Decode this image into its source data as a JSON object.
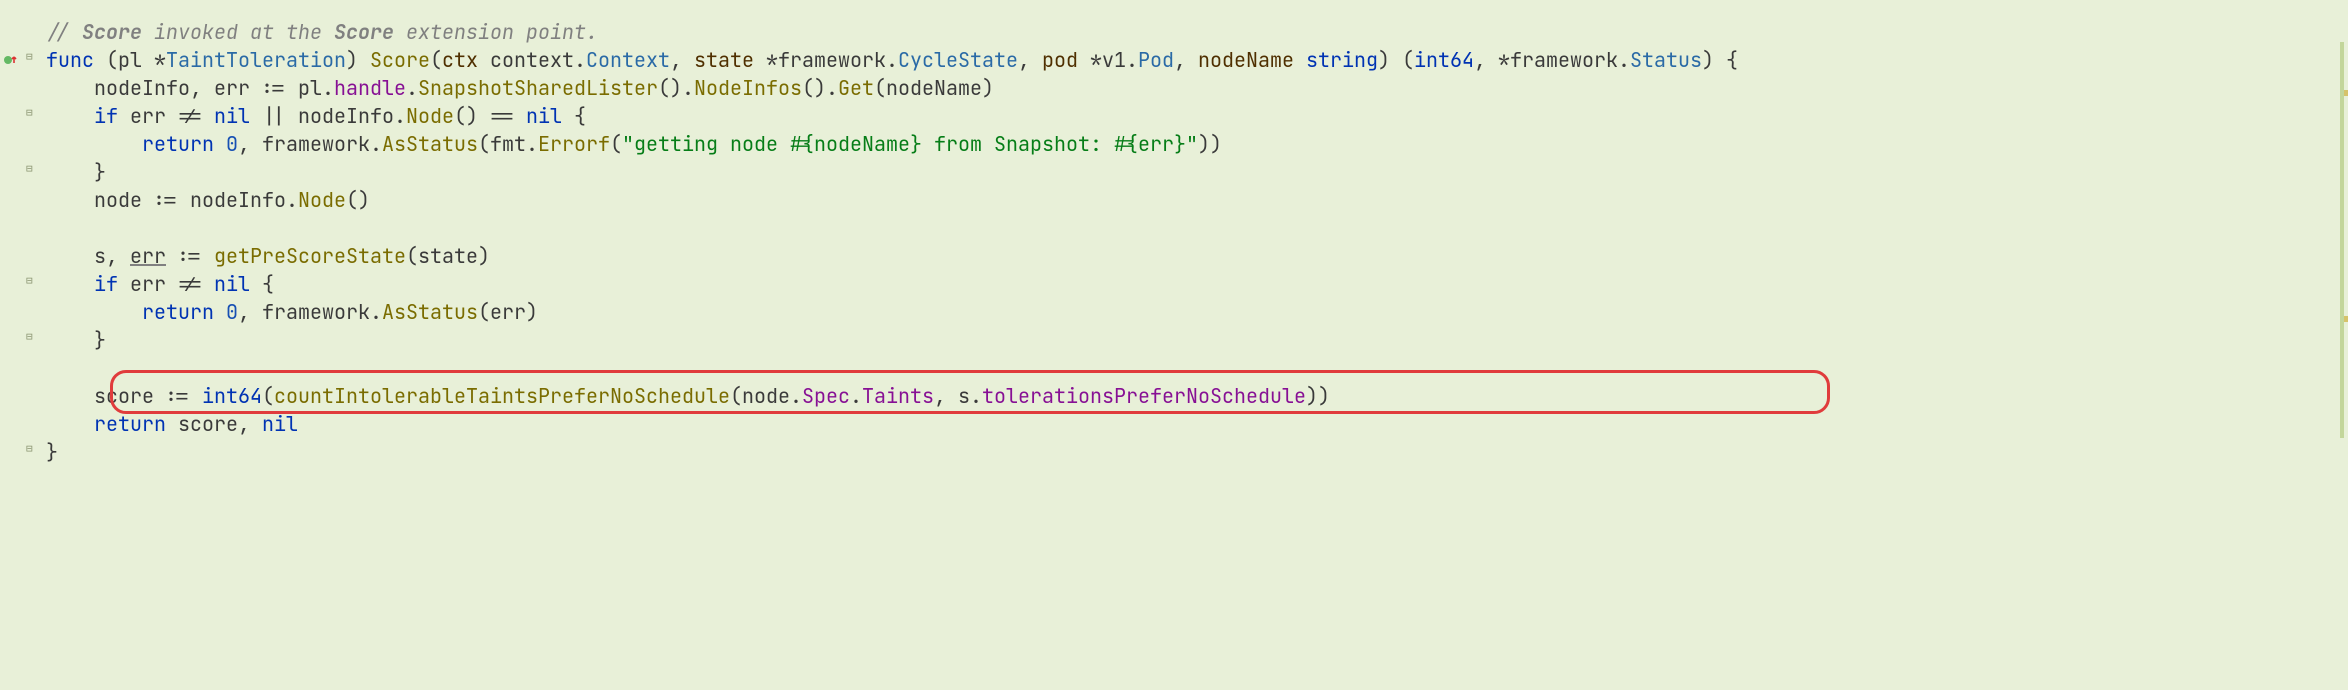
{
  "colors": {
    "bg": "#e8f0d8",
    "highlight_border": "#e03c3c"
  },
  "gutter": {
    "vcs_marker": "modified-up"
  },
  "highlight": {
    "line_index": 13
  },
  "code": {
    "comment_prefix": "// ",
    "comment_word1": "Score",
    "comment_mid": " invoked at the ",
    "comment_word2": "Score",
    "comment_suffix": " extension point.",
    "kw_func": "func",
    "recv_open": " (",
    "recv_name": "pl",
    "recv_star": " *",
    "recv_type": "TaintToleration",
    "recv_close": ") ",
    "fn_name": "Score",
    "sig_open": "(",
    "p1_name": "ctx",
    "p1_sep": " ",
    "p1_pkg": "context",
    "p1_dot": ".",
    "p1_type": "Context",
    "comma": ", ",
    "p2_name": "state",
    "p2_star": " *",
    "p2_pkg": "framework",
    "p2_dot": ".",
    "p2_type": "CycleState",
    "p3_name": "pod",
    "p3_star": " *",
    "p3_pkg": "v1",
    "p3_dot": ".",
    "p3_type": "Pod",
    "p4_name": "nodeName",
    "p4_sep": " ",
    "p4_type": "string",
    "sig_close": ") (",
    "ret1": "int64",
    "ret_comma": ", *",
    "ret2_pkg": "framework",
    "ret2_dot": ".",
    "ret2_type": "Status",
    "ret_close": ") {",
    "l2_indent": "    ",
    "l2_a": "nodeInfo",
    "l2_b": ", ",
    "l2_c": "err",
    "l2_d": " := ",
    "l2_e": "pl",
    "l2_f": ".",
    "l2_g": "handle",
    "l2_h": ".",
    "l2_i": "SnapshotSharedLister",
    "l2_j": "().",
    "l2_k": "NodeInfos",
    "l2_l": "().",
    "l2_m": "Get",
    "l2_n": "(",
    "l2_o": "nodeName",
    "l2_p": ")",
    "l3_indent": "    ",
    "l3_kw": "if",
    "l3_a": " err != ",
    "l3_nil": "nil",
    "l3_b": " || nodeInfo.",
    "l3_c": "Node",
    "l3_d": "() == ",
    "l3_nil2": "nil",
    "l3_e": " {",
    "l4_indent": "        ",
    "l4_kw": "return",
    "l4_sp": " ",
    "l4_num": "0",
    "l4_a": ", ",
    "l4_pkg": "framework",
    "l4_dot": ".",
    "l4_fn": "AsStatus",
    "l4_b": "(",
    "l4_fmt": "fmt",
    "l4_dot2": ".",
    "l4_errf": "Errorf",
    "l4_c": "(",
    "l4_str": "\"getting node #{nodeName} from Snapshot: #{err}\"",
    "l4_d": "))",
    "l5_indent": "    ",
    "l5_a": "}",
    "l6_indent": "    ",
    "l6_a": "node := nodeInfo.",
    "l6_b": "Node",
    "l6_c": "()",
    "l8_indent": "    ",
    "l8_a": "s",
    "l8_b": ", ",
    "l8_c": "err",
    "l8_d": " := ",
    "l8_e": "getPreScoreState",
    "l8_f": "(",
    "l8_g": "state",
    "l8_h": ")",
    "l9_indent": "    ",
    "l9_kw": "if",
    "l9_a": " err != ",
    "l9_nil": "nil",
    "l9_b": " {",
    "l10_indent": "        ",
    "l10_kw": "return",
    "l10_sp": " ",
    "l10_num": "0",
    "l10_a": ", ",
    "l10_pkg": "framework",
    "l10_dot": ".",
    "l10_fn": "AsStatus",
    "l10_b": "(err)",
    "l11_indent": "    ",
    "l11_a": "}",
    "l13_indent": "    ",
    "l13_a": "score := ",
    "l13_b": "int64",
    "l13_c": "(",
    "l13_d": "countIntolerableTaintsPreferNoSchedule",
    "l13_e": "(node.",
    "l13_f": "Spec",
    "l13_g": ".",
    "l13_h": "Taints",
    "l13_i": ", s.",
    "l13_j": "tolerationsPreferNoSchedule",
    "l13_k": "))",
    "l14_indent": "    ",
    "l14_kw": "return",
    "l14_a": " score, ",
    "l14_nil": "nil",
    "l15_a": "}"
  }
}
